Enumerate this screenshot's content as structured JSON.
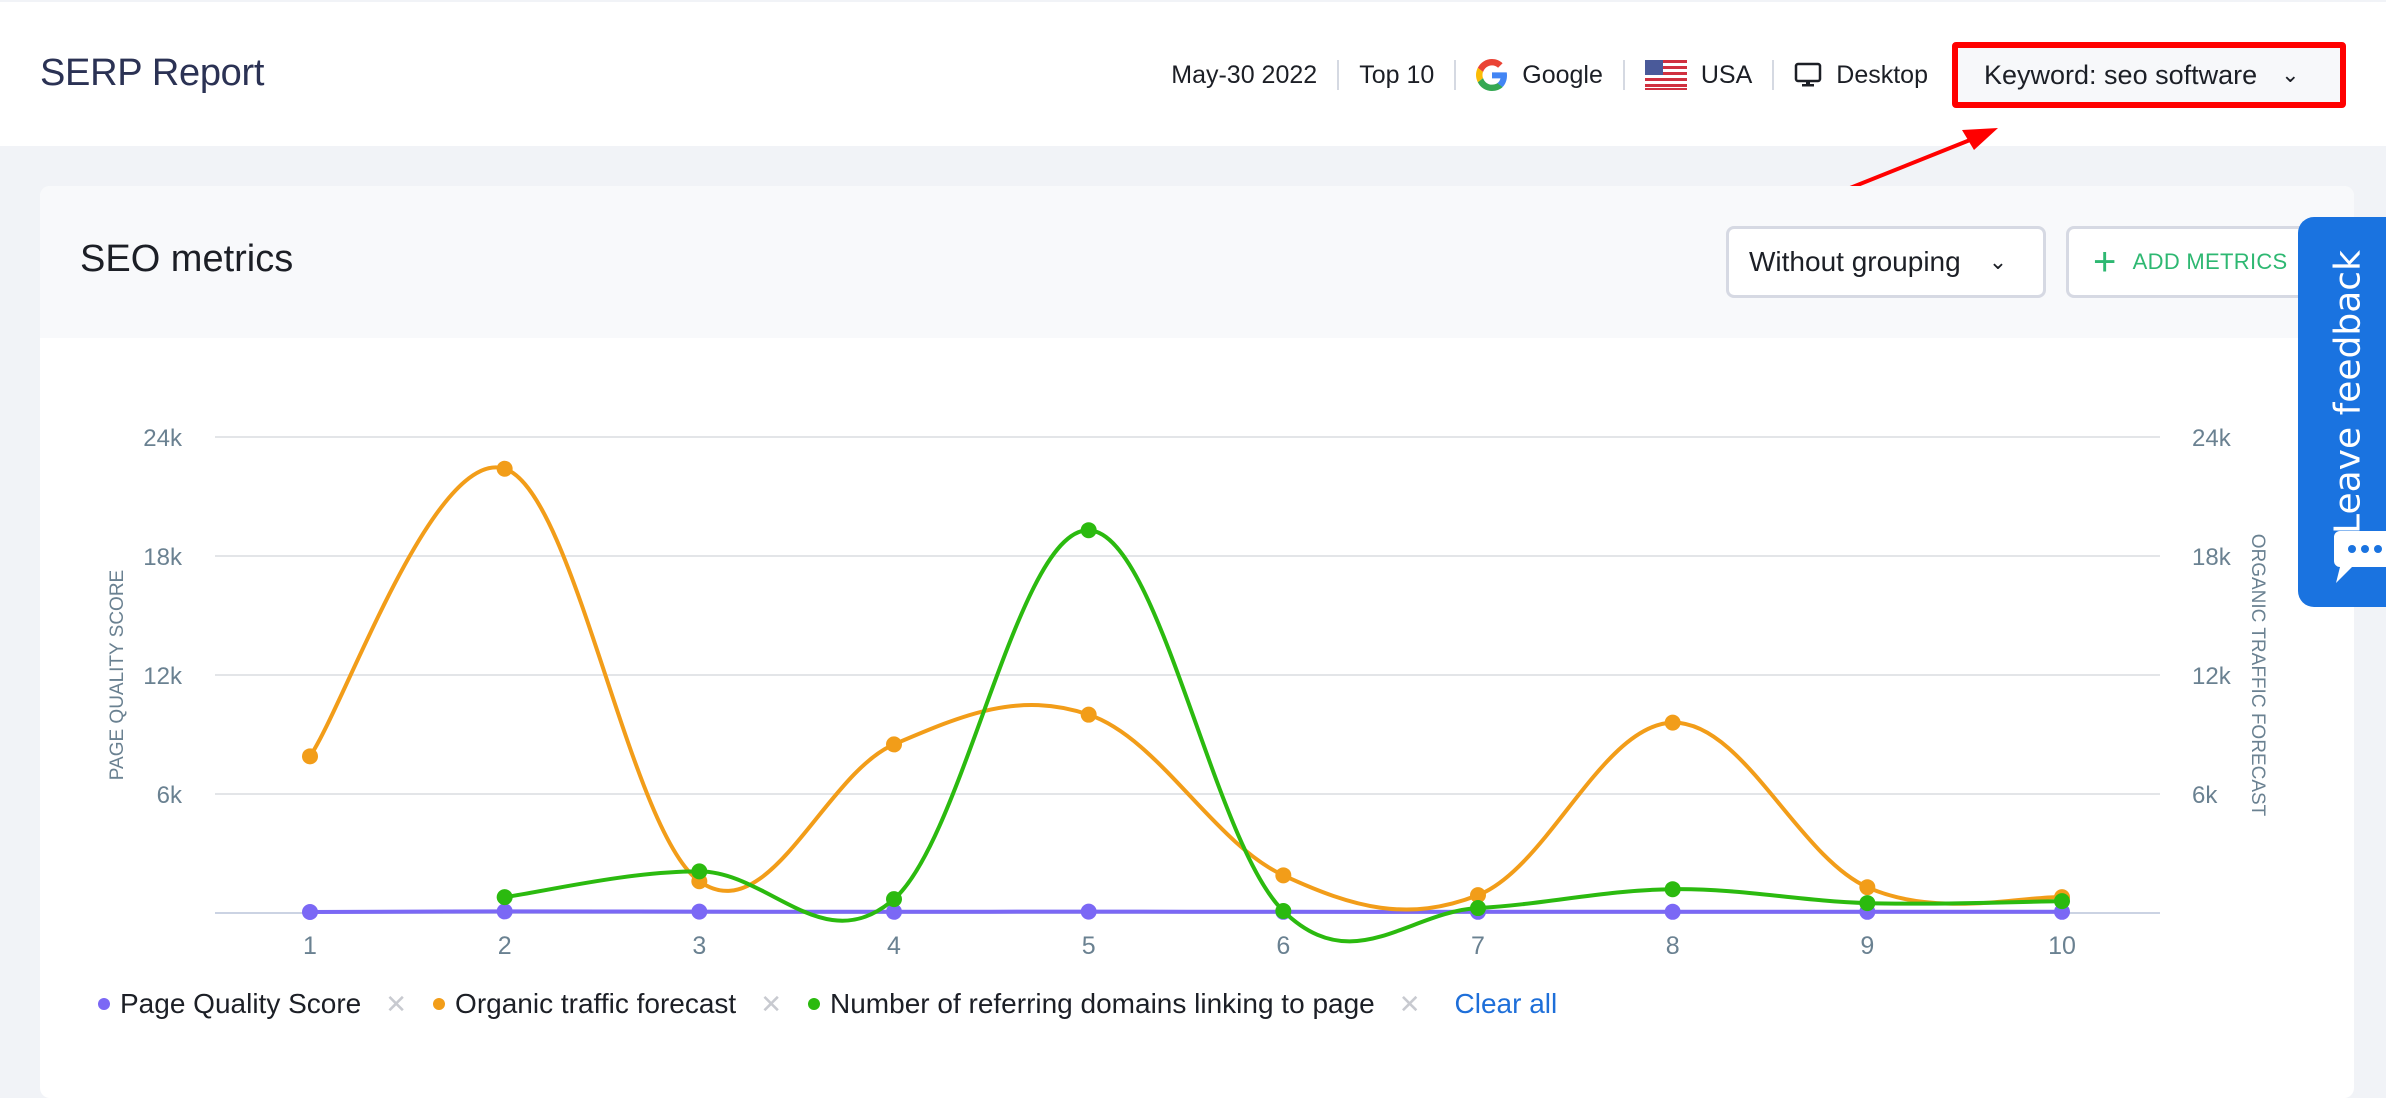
{
  "header": {
    "title": "SERP Report",
    "date": "May-30 2022",
    "top": "Top 10",
    "engine": "Google",
    "country": "USA",
    "device": "Desktop",
    "keyword_select": "Keyword: seo software"
  },
  "card": {
    "title": "SEO metrics",
    "grouping_select": "Without grouping",
    "add_metrics_label": "ADD METRICS"
  },
  "feedback": {
    "label": "Leave feedback"
  },
  "legend": {
    "items": [
      {
        "label": "Page Quality Score",
        "color": "#7b68f5"
      },
      {
        "label": "Organic traffic forecast",
        "color": "#f29d19"
      },
      {
        "label": "Number of referring domains linking to page",
        "color": "#2bba0f"
      }
    ],
    "clear_all": "Clear all"
  },
  "colors": {
    "accent_blue": "#1a73e0",
    "add_green": "#2eb872",
    "highlight_red": "#ff0000",
    "title_navy": "#2b3254"
  },
  "chart_data": {
    "type": "line",
    "title": "",
    "x": [
      1,
      2,
      3,
      4,
      5,
      6,
      7,
      8,
      9,
      10
    ],
    "categories": [
      "1",
      "2",
      "3",
      "4",
      "5",
      "6",
      "7",
      "8",
      "9",
      "10"
    ],
    "ylabel_left": "PAGE QUALITY SCORE",
    "ylabel_right": "ORGANIC TRAFFIC FORECAST",
    "xlabel": "",
    "ylim": [
      0,
      24000
    ],
    "yticks": [
      {
        "value": 6000,
        "label": "6k"
      },
      {
        "value": 12000,
        "label": "12k"
      },
      {
        "value": 18000,
        "label": "18k"
      },
      {
        "value": 24000,
        "label": "24k"
      }
    ],
    "grid": true,
    "legend_position": "bottom-left",
    "curve": "smooth",
    "series": [
      {
        "name": "Page Quality Score",
        "color": "#7b68f5",
        "values": [
          50,
          80,
          70,
          60,
          70,
          60,
          60,
          60,
          60,
          60
        ]
      },
      {
        "name": "Organic traffic forecast",
        "color": "#f29d19",
        "values": [
          7900,
          22400,
          1600,
          8500,
          10000,
          1900,
          900,
          9600,
          1300,
          800
        ]
      },
      {
        "name": "Number of referring domains linking to page",
        "color": "#2bba0f",
        "values": [
          null,
          800,
          2100,
          700,
          19300,
          100,
          250,
          1200,
          500,
          600
        ]
      }
    ]
  }
}
